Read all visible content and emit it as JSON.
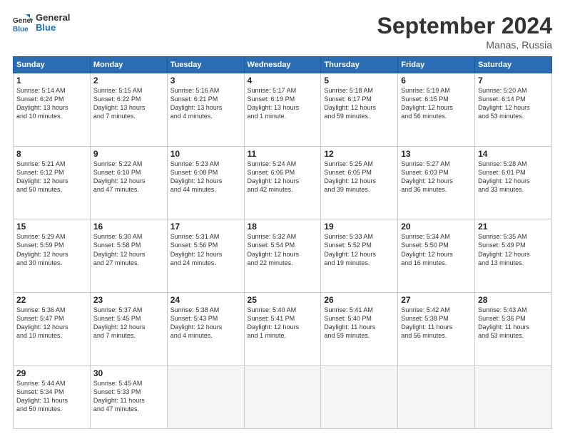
{
  "logo": {
    "line1": "General",
    "line2": "Blue"
  },
  "title": "September 2024",
  "location": "Manas, Russia",
  "weekdays": [
    "Sunday",
    "Monday",
    "Tuesday",
    "Wednesday",
    "Thursday",
    "Friday",
    "Saturday"
  ],
  "weeks": [
    [
      {
        "day": 1,
        "info": "Sunrise: 5:14 AM\nSunset: 6:24 PM\nDaylight: 13 hours\nand 10 minutes."
      },
      {
        "day": 2,
        "info": "Sunrise: 5:15 AM\nSunset: 6:22 PM\nDaylight: 13 hours\nand 7 minutes."
      },
      {
        "day": 3,
        "info": "Sunrise: 5:16 AM\nSunset: 6:21 PM\nDaylight: 13 hours\nand 4 minutes."
      },
      {
        "day": 4,
        "info": "Sunrise: 5:17 AM\nSunset: 6:19 PM\nDaylight: 13 hours\nand 1 minute."
      },
      {
        "day": 5,
        "info": "Sunrise: 5:18 AM\nSunset: 6:17 PM\nDaylight: 12 hours\nand 59 minutes."
      },
      {
        "day": 6,
        "info": "Sunrise: 5:19 AM\nSunset: 6:15 PM\nDaylight: 12 hours\nand 56 minutes."
      },
      {
        "day": 7,
        "info": "Sunrise: 5:20 AM\nSunset: 6:14 PM\nDaylight: 12 hours\nand 53 minutes."
      }
    ],
    [
      {
        "day": 8,
        "info": "Sunrise: 5:21 AM\nSunset: 6:12 PM\nDaylight: 12 hours\nand 50 minutes."
      },
      {
        "day": 9,
        "info": "Sunrise: 5:22 AM\nSunset: 6:10 PM\nDaylight: 12 hours\nand 47 minutes."
      },
      {
        "day": 10,
        "info": "Sunrise: 5:23 AM\nSunset: 6:08 PM\nDaylight: 12 hours\nand 44 minutes."
      },
      {
        "day": 11,
        "info": "Sunrise: 5:24 AM\nSunset: 6:06 PM\nDaylight: 12 hours\nand 42 minutes."
      },
      {
        "day": 12,
        "info": "Sunrise: 5:25 AM\nSunset: 6:05 PM\nDaylight: 12 hours\nand 39 minutes."
      },
      {
        "day": 13,
        "info": "Sunrise: 5:27 AM\nSunset: 6:03 PM\nDaylight: 12 hours\nand 36 minutes."
      },
      {
        "day": 14,
        "info": "Sunrise: 5:28 AM\nSunset: 6:01 PM\nDaylight: 12 hours\nand 33 minutes."
      }
    ],
    [
      {
        "day": 15,
        "info": "Sunrise: 5:29 AM\nSunset: 5:59 PM\nDaylight: 12 hours\nand 30 minutes."
      },
      {
        "day": 16,
        "info": "Sunrise: 5:30 AM\nSunset: 5:58 PM\nDaylight: 12 hours\nand 27 minutes."
      },
      {
        "day": 17,
        "info": "Sunrise: 5:31 AM\nSunset: 5:56 PM\nDaylight: 12 hours\nand 24 minutes."
      },
      {
        "day": 18,
        "info": "Sunrise: 5:32 AM\nSunset: 5:54 PM\nDaylight: 12 hours\nand 22 minutes."
      },
      {
        "day": 19,
        "info": "Sunrise: 5:33 AM\nSunset: 5:52 PM\nDaylight: 12 hours\nand 19 minutes."
      },
      {
        "day": 20,
        "info": "Sunrise: 5:34 AM\nSunset: 5:50 PM\nDaylight: 12 hours\nand 16 minutes."
      },
      {
        "day": 21,
        "info": "Sunrise: 5:35 AM\nSunset: 5:49 PM\nDaylight: 12 hours\nand 13 minutes."
      }
    ],
    [
      {
        "day": 22,
        "info": "Sunrise: 5:36 AM\nSunset: 5:47 PM\nDaylight: 12 hours\nand 10 minutes."
      },
      {
        "day": 23,
        "info": "Sunrise: 5:37 AM\nSunset: 5:45 PM\nDaylight: 12 hours\nand 7 minutes."
      },
      {
        "day": 24,
        "info": "Sunrise: 5:38 AM\nSunset: 5:43 PM\nDaylight: 12 hours\nand 4 minutes."
      },
      {
        "day": 25,
        "info": "Sunrise: 5:40 AM\nSunset: 5:41 PM\nDaylight: 12 hours\nand 1 minute."
      },
      {
        "day": 26,
        "info": "Sunrise: 5:41 AM\nSunset: 5:40 PM\nDaylight: 11 hours\nand 59 minutes."
      },
      {
        "day": 27,
        "info": "Sunrise: 5:42 AM\nSunset: 5:38 PM\nDaylight: 11 hours\nand 56 minutes."
      },
      {
        "day": 28,
        "info": "Sunrise: 5:43 AM\nSunset: 5:36 PM\nDaylight: 11 hours\nand 53 minutes."
      }
    ],
    [
      {
        "day": 29,
        "info": "Sunrise: 5:44 AM\nSunset: 5:34 PM\nDaylight: 11 hours\nand 50 minutes."
      },
      {
        "day": 30,
        "info": "Sunrise: 5:45 AM\nSunset: 5:33 PM\nDaylight: 11 hours\nand 47 minutes."
      },
      null,
      null,
      null,
      null,
      null
    ]
  ]
}
